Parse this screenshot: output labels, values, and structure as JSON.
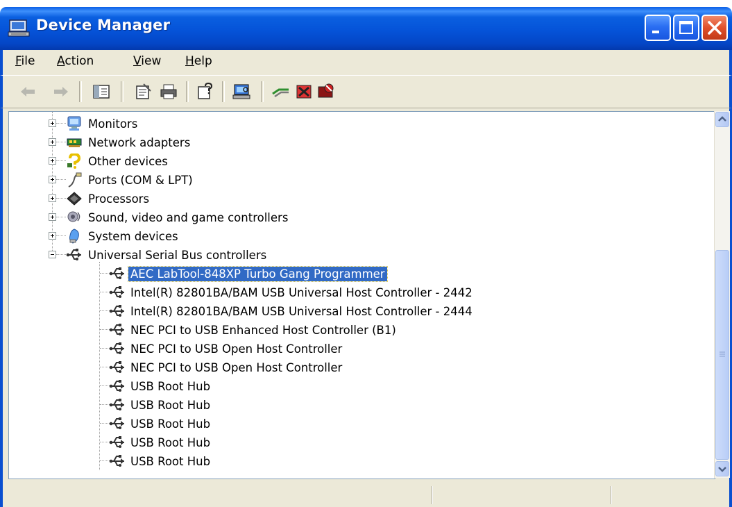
{
  "window": {
    "title": "Device Manager"
  },
  "menu": [
    {
      "label": "File",
      "accel": "F",
      "rest": "ile"
    },
    {
      "label": "Action",
      "accel": "A",
      "rest": "ction"
    },
    {
      "label": "View",
      "accel": "V",
      "rest": "iew"
    },
    {
      "label": "Help",
      "accel": "H",
      "rest": "elp"
    }
  ],
  "toolbar": {
    "icons": [
      "back-arrow-icon",
      "forward-arrow-icon",
      "show-hide-console-tree-icon",
      "properties-icon",
      "print-icon",
      "help-icon",
      "scan-hardware-icon",
      "update-driver-icon",
      "uninstall-icon",
      "disable-icon"
    ]
  },
  "tree": {
    "categories": [
      {
        "label": "Monitors",
        "icon": "monitor-icon",
        "expanded": false
      },
      {
        "label": "Network adapters",
        "icon": "network-adapter-icon",
        "expanded": false
      },
      {
        "label": "Other devices",
        "icon": "question-mark-icon",
        "expanded": false
      },
      {
        "label": "Ports (COM & LPT)",
        "icon": "port-icon",
        "expanded": false
      },
      {
        "label": "Processors",
        "icon": "processor-icon",
        "expanded": false
      },
      {
        "label": "Sound, video and game controllers",
        "icon": "speaker-icon",
        "expanded": false
      },
      {
        "label": "System devices",
        "icon": "system-device-icon",
        "expanded": false
      },
      {
        "label": "Universal Serial Bus controllers",
        "icon": "usb-icon",
        "expanded": true
      }
    ],
    "usb_devices": [
      {
        "label": "AEC LabTool-848XP Turbo Gang Programmer",
        "selected": true
      },
      {
        "label": "Intel(R) 82801BA/BAM USB Universal Host Controller - 2442",
        "selected": false
      },
      {
        "label": "Intel(R) 82801BA/BAM USB Universal Host Controller - 2444",
        "selected": false
      },
      {
        "label": "NEC PCI to USB Enhanced Host Controller (B1)",
        "selected": false
      },
      {
        "label": "NEC PCI to USB Open Host Controller",
        "selected": false
      },
      {
        "label": "NEC PCI to USB Open Host Controller",
        "selected": false
      },
      {
        "label": "USB Root Hub",
        "selected": false
      },
      {
        "label": "USB Root Hub",
        "selected": false
      },
      {
        "label": "USB Root Hub",
        "selected": false
      },
      {
        "label": "USB Root Hub",
        "selected": false
      },
      {
        "label": "USB Root Hub",
        "selected": false
      }
    ]
  },
  "colors": {
    "titlebar": "#0553d8",
    "selection": "#316ac5",
    "chrome": "#ece9d8"
  }
}
